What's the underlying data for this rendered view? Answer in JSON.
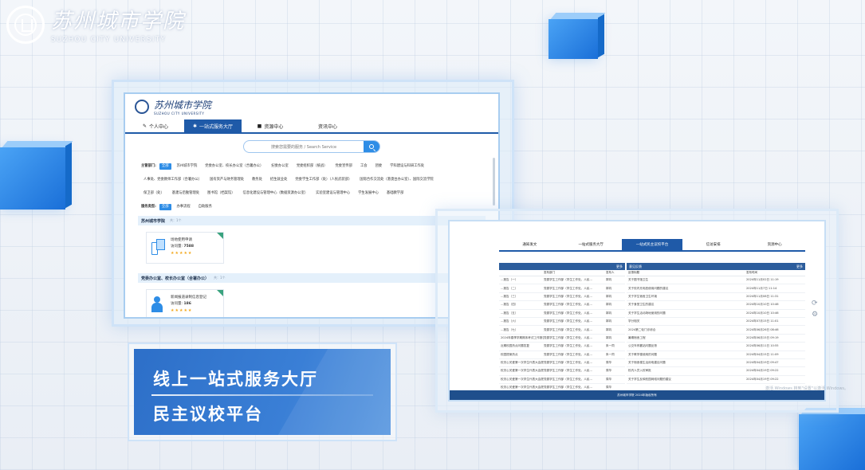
{
  "brand": {
    "name_cn": "苏州城市学院",
    "name_en": "SUZHOU CITY UNIVERSITY"
  },
  "portal": {
    "nav": [
      {
        "label": "个人中心",
        "icon": "person-icon",
        "active": false
      },
      {
        "label": "一站式服务大厅",
        "icon": "gear-icon",
        "active": true
      },
      {
        "label": "资源中心",
        "icon": "square-icon",
        "active": false
      },
      {
        "label": "资讯中心",
        "icon": "",
        "active": false
      }
    ],
    "search_placeholder": "搜索您需要的服务 / Search Service",
    "dept_label": "主管部门:",
    "dept_row1": [
      "全部",
      "苏州城市学院",
      "党委办公室、校长办公室（合署办公）",
      "纪委办公室",
      "党委组织部（统战）",
      "党委宣传部",
      "工会",
      "团委",
      "学科建设与科研工作处"
    ],
    "dept_row2": [
      "人事处、党委教师工作部（合署办公）",
      "国有资产与财务管理处",
      "教务处",
      "招生就业处",
      "党委学生工作部（处）（人民武装部）",
      "国际合作交流处（港澳台办公室）、国际交流学院"
    ],
    "dept_row3": [
      "保卫部（处）",
      "基建与后勤管理处",
      "图书馆（档案馆）",
      "信息化建设与管理中心（数据资源办公室）",
      "实验室建设与管理中心",
      "学生发展中心",
      "基础教学部"
    ],
    "type_label": "服务类型:",
    "types": [
      "全部",
      "办事流程",
      "自助服务"
    ],
    "sections": [
      {
        "title": "苏州城市学院",
        "count": "共：1个",
        "service": "场地使用申请",
        "visits_label": "访问量:",
        "visits": "7588",
        "stars": "★★★★★"
      },
      {
        "title": "党委办公室、校长办公室（合署办公）",
        "count": "共：1个",
        "service": "新闻报道录制信息登记",
        "visits_label": "访问量:",
        "visits": "186",
        "stars": "★★★★★"
      }
    ]
  },
  "portal2": {
    "nav": [
      {
        "label": "通知发文",
        "active": false
      },
      {
        "label": "一站式服务大厅",
        "active": false
      },
      {
        "label": "一站式民主议校平台",
        "active": true
      },
      {
        "label": "信访安排",
        "active": false
      },
      {
        "label": "资源中心",
        "active": false
      }
    ],
    "left_more": "更多",
    "left_headers": [
      "",
      "发布部门",
      "发布人"
    ],
    "left_rows": [
      [
        "...报告（一）",
        "党委学生工作部（学生工作处、人民...",
        "郭钧"
      ],
      [
        "...报告（二）",
        "党委学生工作部（学生工作处、人民...",
        "郭钧"
      ],
      [
        "...报告（三）",
        "党委学生工作部（学生工作处、人民...",
        "郭钧"
      ],
      [
        "...报告（四）",
        "党委学生工作部（学生工作处、人民...",
        "郭钧"
      ],
      [
        "...报告（五）",
        "党委学生工作部（学生工作处、人民...",
        "郭钧"
      ],
      [
        "...报告（六）",
        "党委学生工作部（学生工作处、人民...",
        "郭钧"
      ],
      [
        "...报告（七）",
        "党委学生工作部（学生工作处、人民...",
        "郭钧"
      ],
      [
        "2024年春季学期期末考试工作报告",
        "党委学生工作部（学生工作处、人民...",
        "郭钧"
      ],
      [
        "近期校园热点问题答复",
        "党委学生工作部（学生工作处、人民...",
        "朱一同"
      ],
      [
        "校园提案热点",
        "党委学生工作部（学生工作处、人民...",
        "朱一同"
      ],
      [
        "校关心关爱第一次学生代表大会提案答复表（四国...",
        "党委学生工作部（学生工作处、人民...",
        "周华"
      ],
      [
        "校关心关爱第一次学生代表大会提案答复表（信息...",
        "党委学生工作部（学生工作处、人民...",
        "周华"
      ],
      [
        "校关心关爱第一次学生代表大会提案答复表（国际...",
        "党委学生工作部（学生工作处、人民...",
        "周华"
      ],
      [
        "校关心关爱第一次学生代表大会提案答复表（党委...",
        "党委学生工作部（学生工作处、人民...",
        "周华"
      ]
    ],
    "right_title": "意见反馈",
    "right_more": "更多",
    "right_headers": [
      "反馈标题",
      "发布时间"
    ],
    "right_rows": [
      [
        "关于图书馆卫生",
        "2024年11月02日 11:19"
      ],
      [
        "关于校内充电桩使用问题的建议",
        "2024年11月7日 11:14"
      ],
      [
        "关于学生宿舍卫生环境",
        "2024年11月08日 11:31"
      ],
      [
        "关于食堂卫生的建议",
        "2024年10月10日 10:46"
      ],
      [
        "关于学生活动场地使用的问题",
        "2024年10月10日 10:46"
      ],
      [
        "学分相关",
        "2024年07月15日 11:01"
      ],
      [
        "2024第二轮门诊综合",
        "2024年06月26日 08:46"
      ],
      [
        "暑期宿舍工程",
        "2024年06月15日 09:19"
      ],
      [
        "公交车停靠站问题反馈",
        "2024年06月11日 10:55"
      ],
      [
        "关于教学楼使用的问题",
        "2024年04月15日 11:09"
      ],
      [
        "关于宿舍楼生活用电建议问题",
        "2024年04月19日 09:47"
      ],
      [
        "校内人员入校审批",
        "2024年04月19日 09:22"
      ],
      [
        "关于学生反映校园网络问题的建议",
        "2024年04月19日 09:22"
      ]
    ],
    "footer": "苏州城市学院  2024年版权所有"
  },
  "banner": {
    "line1": "线上一站式服务大厅",
    "line2": "民主议校平台"
  },
  "watermark": "激活 Windows 转到\"设置\"以激活 Windows。"
}
